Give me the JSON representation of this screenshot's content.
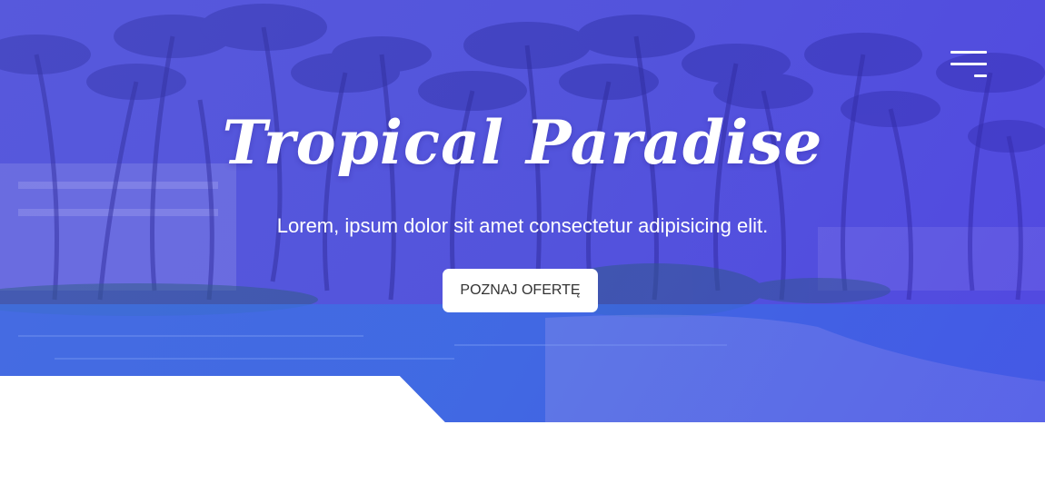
{
  "hero": {
    "title": "Tropical Paradise",
    "subtitle": "Lorem, ipsum dolor sit amet consectetur adipisicing elit.",
    "cta_label": "POZNAJ OFERTĘ",
    "background_image": "tropical-resort-pool-with-palm-trees",
    "overlay_color": "#4a4ad8"
  },
  "nav": {
    "menu_icon": "hamburger-menu-icon"
  },
  "colors": {
    "accent": "#4a4ad8",
    "button_bg": "#ffffff",
    "button_text": "#333333",
    "text": "#ffffff"
  }
}
